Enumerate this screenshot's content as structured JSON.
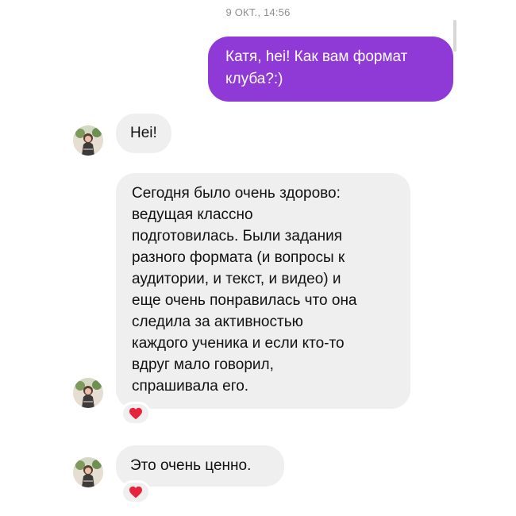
{
  "chat": {
    "timestamp": "9 ОКТ., 14:56",
    "outgoing": {
      "text_lines": [
        "Катя, hei! Как вам формат",
        "клуба?:)"
      ]
    },
    "incoming": [
      {
        "lines": [
          "Hei!"
        ]
      },
      {
        "lines": [
          "Сегодня было очень здорово:",
          "ведущая классно",
          "подготовилась. Были задания",
          "разного формата (и вопросы к",
          "аудитории, и текст, и видео) и",
          "еще очень понравилась что она",
          "следила за активностью",
          "каждого ученика и если кто-то",
          "вдруг мало говорил,",
          "спрашивала его."
        ],
        "reaction": "heart-icon"
      },
      {
        "lines": [
          "Это очень ценно."
        ],
        "reaction": "heart-icon"
      }
    ]
  },
  "colors": {
    "outgoing_bubble": "#8f3ad6",
    "incoming_bubble": "#efefef",
    "reaction_heart": "#e8243c",
    "timestamp": "#8e8e8e"
  }
}
